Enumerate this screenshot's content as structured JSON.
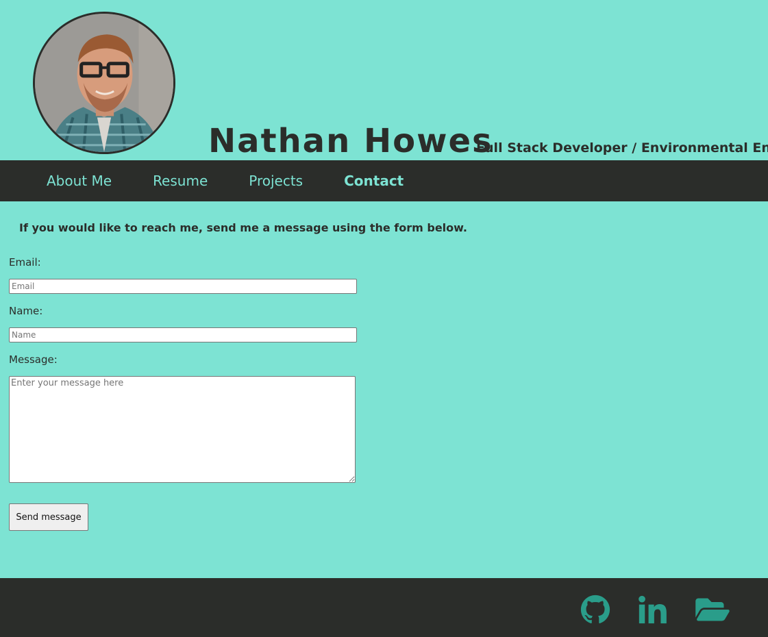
{
  "header": {
    "name": "Nathan Howes",
    "tagline": "Full Stack Developer / Environmental Engineer"
  },
  "nav": {
    "items": [
      {
        "label": "About Me"
      },
      {
        "label": "Resume"
      },
      {
        "label": "Projects"
      },
      {
        "label": "Contact",
        "active": true
      }
    ]
  },
  "contact": {
    "intro": "If you would like to reach me, send me a message using the form below.",
    "email_label": "Email:",
    "email_placeholder": "Email",
    "name_label": "Name:",
    "name_placeholder": "Name",
    "message_label": "Message:",
    "message_placeholder": "Enter your message here",
    "send_label": "Send message"
  },
  "footer": {
    "icons": [
      "github-icon",
      "linkedin-icon",
      "folder-open-icon"
    ]
  },
  "colors": {
    "background": "#7de3d3",
    "dark": "#2b2d2a",
    "footer_icon": "#2a9d8a"
  }
}
